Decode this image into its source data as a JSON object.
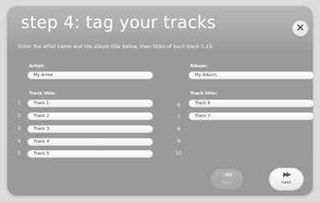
{
  "dialog": {
    "title": "step 4: tag your tracks",
    "close_glyph": "✕",
    "instruction": "Enter the artist name and the album title below, then titles of each track 1-10."
  },
  "artist": {
    "label": "Artist:",
    "value": "My Artist"
  },
  "album": {
    "label": "Album:",
    "value": "My Album"
  },
  "tracks": {
    "label_left": "Track title:",
    "label_right": "Track title:",
    "left": [
      {
        "number": "1",
        "value": "Track 1"
      },
      {
        "number": "2",
        "value": "Track 2"
      },
      {
        "number": "3",
        "value": "Track 3"
      },
      {
        "number": "4",
        "value": "Track 4"
      },
      {
        "number": "5",
        "value": "Track 5"
      }
    ],
    "right": [
      {
        "number": "6",
        "value": "Track 6"
      },
      {
        "number": "7",
        "value": "Track 7"
      },
      {
        "number": "8",
        "value": ""
      },
      {
        "number": "9",
        "value": ""
      },
      {
        "number": "10",
        "value": ""
      }
    ]
  },
  "nav": {
    "back_label": "back",
    "back_icon": "rewind-icon",
    "back_glyph": "◀◀",
    "next_label": "next",
    "next_icon": "fast-forward-icon",
    "next_glyph": "▶▶"
  }
}
